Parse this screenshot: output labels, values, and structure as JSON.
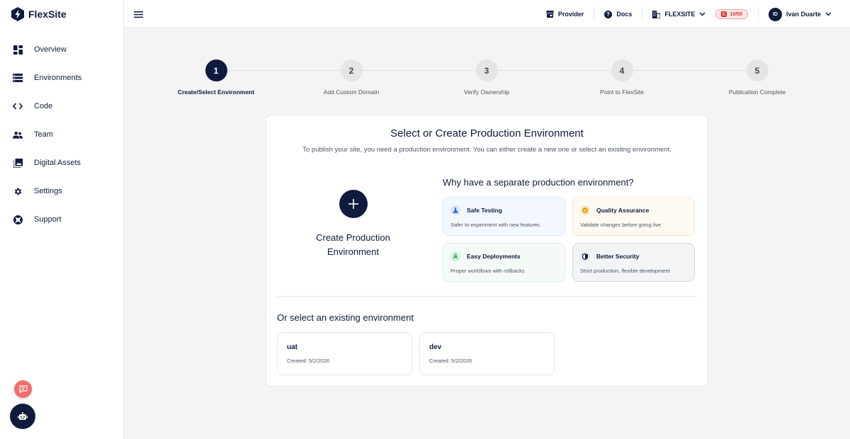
{
  "app": {
    "name": "FlexSite"
  },
  "sidebar": {
    "items": [
      {
        "label": "Overview",
        "icon": "dashboard-icon"
      },
      {
        "label": "Environments",
        "icon": "server-icon"
      },
      {
        "label": "Code",
        "icon": "code-icon"
      },
      {
        "label": "Team",
        "icon": "team-icon"
      },
      {
        "label": "Digital Assets",
        "icon": "image-gallery-icon"
      },
      {
        "label": "Settings",
        "icon": "gear-icon"
      },
      {
        "label": "Support",
        "icon": "lifebuoy-icon"
      }
    ]
  },
  "topbar": {
    "provider_label": "Provider",
    "docs_label": "Docs",
    "org_label": "FLEXSITE",
    "credits": "10/50",
    "user_initials": "ID",
    "user_name": "Ivan Duarte"
  },
  "stepper": {
    "steps": [
      {
        "number": "1",
        "label": "Create/Select Environment",
        "active": true
      },
      {
        "number": "2",
        "label": "Add Custom Domain",
        "active": false
      },
      {
        "number": "3",
        "label": "Verify Ownership",
        "active": false
      },
      {
        "number": "4",
        "label": "Point to FlexSite",
        "active": false
      },
      {
        "number": "5",
        "label": "Publication Complete",
        "active": false
      }
    ]
  },
  "card": {
    "title": "Select or Create Production Environment",
    "subtitle": "To publish your site, you need a production environment. You can either create a new one or select an existing environment.",
    "create_label_line1": "Create Production",
    "create_label_line2": "Environment",
    "why_title": "Why have a separate production environment?",
    "features": [
      {
        "title": "Safe Testing",
        "desc": "Safer to experiment with new features",
        "bg": "#f3f8fe",
        "border": "#dbe8fb",
        "icon_bg": "#dbe8fb",
        "icon_color": "#3b6fd9"
      },
      {
        "title": "Quality Assurance",
        "desc": "Validate changes before going live",
        "bg": "#fefaf2",
        "border": "#f5e8cc",
        "icon_bg": "#fbe9c2",
        "icon_color": "#e8a317"
      },
      {
        "title": "Easy Deployments",
        "desc": "Proper workflows with rollbacks",
        "bg": "#f4fbf6",
        "border": "#dcefe2",
        "icon_bg": "#d6f0de",
        "icon_color": "#22a052"
      },
      {
        "title": "Better Security",
        "desc": "Strict production, flexible development",
        "bg": "#f3f4f6",
        "border": "#d1d5db",
        "icon_bg": "#dfe2e8",
        "icon_color": "#0f1b3d"
      }
    ],
    "existing_title": "Or select an existing environment",
    "environments": [
      {
        "name": "uat",
        "created": "Created: 5/2/2026"
      },
      {
        "name": "dev",
        "created": "Created: 5/2/2026"
      }
    ]
  }
}
